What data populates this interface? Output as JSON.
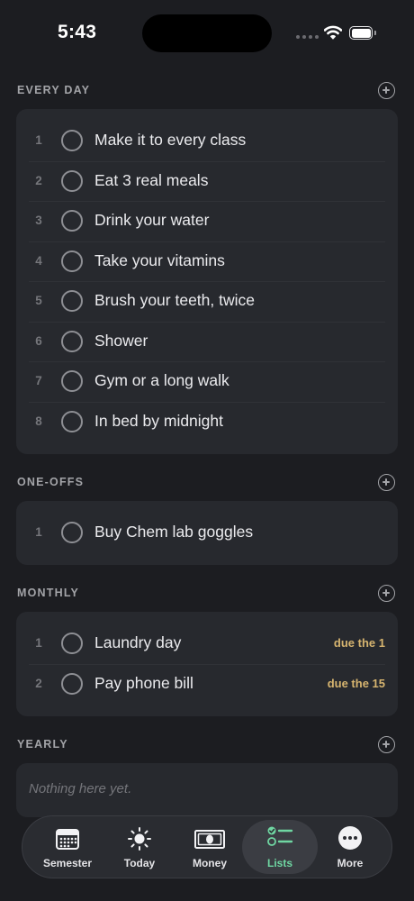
{
  "status_bar": {
    "time": "5:43"
  },
  "sections": [
    {
      "title": "EVERY DAY",
      "items": [
        {
          "num": "1",
          "label": "Make it to every class"
        },
        {
          "num": "2",
          "label": "Eat 3 real meals"
        },
        {
          "num": "3",
          "label": "Drink your water"
        },
        {
          "num": "4",
          "label": "Take your vitamins"
        },
        {
          "num": "5",
          "label": "Brush your teeth, twice"
        },
        {
          "num": "6",
          "label": "Shower"
        },
        {
          "num": "7",
          "label": "Gym or a long walk"
        },
        {
          "num": "8",
          "label": "In bed by midnight"
        }
      ]
    },
    {
      "title": "ONE-OFFS",
      "items": [
        {
          "num": "1",
          "label": "Buy Chem lab goggles"
        }
      ]
    },
    {
      "title": "MONTHLY",
      "items": [
        {
          "num": "1",
          "label": "Laundry day",
          "due": "due the 1"
        },
        {
          "num": "2",
          "label": "Pay phone bill",
          "due": "due the 15"
        }
      ]
    },
    {
      "title": "YEARLY",
      "empty": "Nothing here yet.",
      "items": []
    }
  ],
  "tabs": [
    {
      "label": "Semester",
      "icon": "calendar-icon"
    },
    {
      "label": "Today",
      "icon": "sun-icon"
    },
    {
      "label": "Money",
      "icon": "banknote-icon"
    },
    {
      "label": "Lists",
      "icon": "checklist-icon",
      "active": true
    },
    {
      "label": "More",
      "icon": "ellipsis-icon"
    }
  ],
  "colors": {
    "accent": "#6fd6a2",
    "due": "#d6b46f",
    "background": "#1c1d21",
    "card": "#27292e"
  }
}
